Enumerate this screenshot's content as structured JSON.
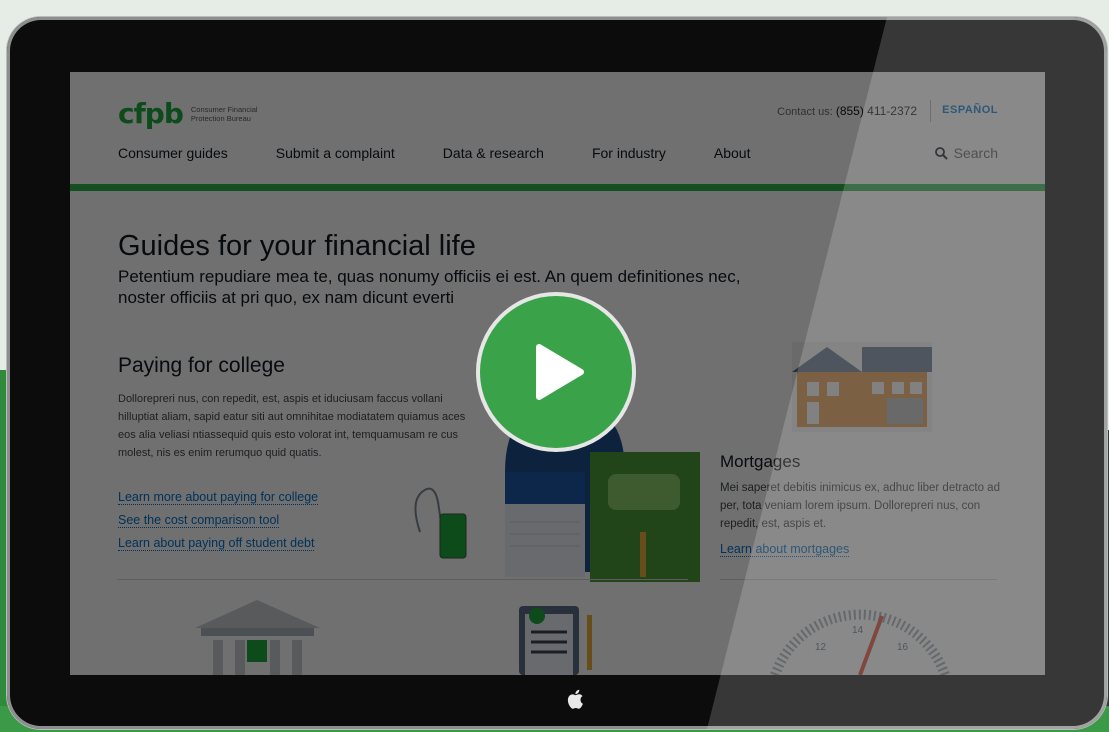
{
  "site": {
    "logo_mark": "cfpb",
    "logo_text": "Consumer Financial Protection Bureau",
    "contact_label": "Contact us:",
    "contact_phone": "(855) 411-2372",
    "language_link": "ESPAÑOL",
    "search_label": "Search",
    "nav": [
      {
        "label": "Consumer guides"
      },
      {
        "label": "Submit a complaint"
      },
      {
        "label": "Data & research"
      },
      {
        "label": "For industry"
      },
      {
        "label": "About"
      }
    ]
  },
  "main": {
    "title": "Guides for your financial life",
    "intro": "Petentium repudiare mea te, quas nonumy officiis ei est. An quem definitiones nec, noster officiis at pri quo, ex nam dicunt everti",
    "college": {
      "title": "Paying for college",
      "body": "Dollorepreri nus, con repedit, est, aspis et iduciusam faccus vollani hilluptiat aliam, sapid eatur siti aut omnihitae modiatatem quiamus aces eos alia veliasi ntiassequid quis esto volorat int, temquamusam re cus molest, nis es enim rerumquo quid quatis.",
      "links": [
        "Learn more about paying for college",
        "See the cost comparison tool",
        "Learn about paying off student debt"
      ]
    },
    "mortgages": {
      "title": "Mortgages",
      "body": "Mei saperet debitis inimicus ex, adhuc liber detracto ad per, tota veniam lorem ipsum. Dollorepreri nus, con repedit, est, aspis et.",
      "link": "Learn about mortgages"
    },
    "gauge_ticks": [
      "12",
      "14",
      "16"
    ]
  },
  "colors": {
    "brand_green": "#20aa3f",
    "link_blue": "#0072ce",
    "play_green": "#3aa34a"
  }
}
